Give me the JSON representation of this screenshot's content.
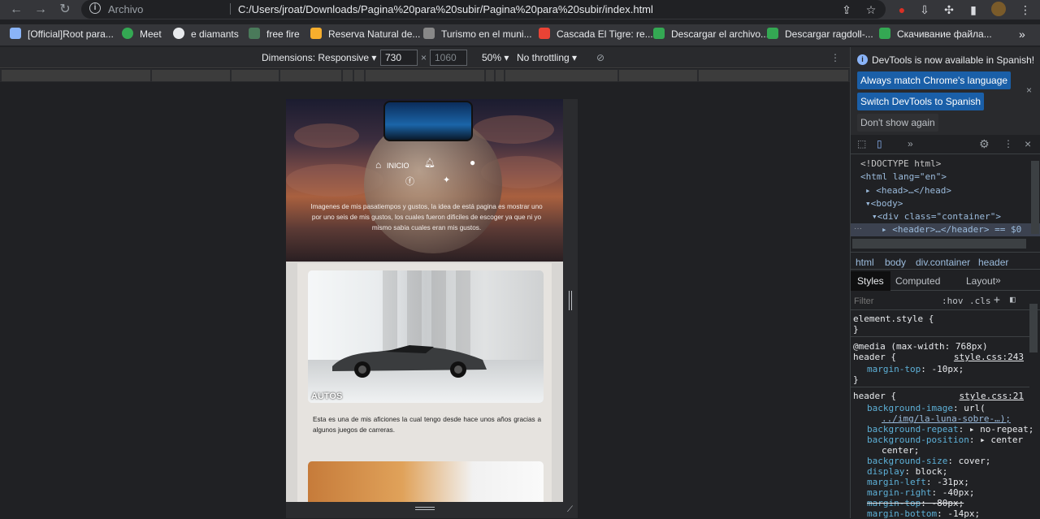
{
  "browser": {
    "scheme_label": "Archivo",
    "url": "C:/Users/jroat/Downloads/Pagina%20para%20subir/Pagina%20para%20subir/index.html"
  },
  "bookmarks": [
    {
      "label": "[Official]Root para...",
      "color": "#f28b82"
    },
    {
      "label": "Meet",
      "color": "#34a853"
    },
    {
      "label": "e diamants",
      "color": "#ffffff"
    },
    {
      "label": "free fire",
      "color": "#5bb974"
    },
    {
      "label": "Reserva Natural de...",
      "color": "#f6ae2d"
    },
    {
      "label": "Turismo en el muni...",
      "color": "#aaaaaa"
    },
    {
      "label": "Cascada El Tigre: re...",
      "color": "#ea4335"
    },
    {
      "label": "Descargar el archivo...",
      "color": "#34a853"
    },
    {
      "label": "Descargar ragdoll-...",
      "color": "#34a853"
    },
    {
      "label": "Скачивание файла...",
      "color": "#34a853"
    }
  ],
  "device_toolbar": {
    "dimensions_label": "Dimensions: Responsive",
    "width_value": "730",
    "times": "×",
    "height_value": "1060",
    "zoom": "50%",
    "throttle": "No throttling"
  },
  "page": {
    "nav_home": "INICIO",
    "hero_text": "Imagenes de mis pasatiempos y gustos, la idea de está pagina es mostrar uno por uno seis de mis gustos, los cuales fueron dificiles de escoger ya que ni yo mismo sabia cuales eran mis gustos.",
    "card_title": "AUTOS",
    "card_text": "Esta es una de mis aficiones la cual tengo desde hace unos años gracias a algunos juegos de carreras."
  },
  "devtools": {
    "notice": "DevTools is now available in Spanish!",
    "btn_match": "Always match Chrome's language",
    "btn_switch": "Switch DevTools to Spanish",
    "btn_dont": "Don't show again",
    "dom": {
      "doctype": "<!DOCTYPE html>",
      "html_open": "<html lang=\"en\">",
      "head": "<head>…</head>",
      "body": "<body>",
      "div": "<div class=\"container\">",
      "header": "<header>…</header> == $0"
    },
    "breadcrumbs": [
      "html",
      "body",
      "div.container",
      "header"
    ],
    "tabs": [
      "Styles",
      "Computed",
      "Layout"
    ],
    "filter_placeholder": "Filter",
    "hov": ":hov",
    "cls": ".cls",
    "element_style": "element.style {",
    "close_brace": "}",
    "media_query": "@media (max-width: 768px)",
    "rule1_selector": "header {",
    "rule1_source": "style.css:243",
    "rule1_prop": "margin-top",
    "rule1_val": "-10px;",
    "rule2_selector": "header {",
    "rule2_source": "style.css:21",
    "rule2_props": [
      {
        "p": "background-image",
        "v": "url("
      },
      {
        "p": "",
        "v": "../img/la-luna-sobre-…);"
      },
      {
        "p": "background-repeat",
        "v": "▸ no-repeat;"
      },
      {
        "p": "background-position",
        "v": "▸ center"
      },
      {
        "p": "",
        "v": "center;"
      },
      {
        "p": "background-size",
        "v": "cover;"
      },
      {
        "p": "display",
        "v": "block;"
      },
      {
        "p": "margin-left",
        "v": "-31px;"
      },
      {
        "p": "margin-right",
        "v": "-40px;"
      },
      {
        "p": "margin-top",
        "v": "-80px;"
      },
      {
        "p": "margin-bottom",
        "v": "-14px;"
      }
    ]
  }
}
